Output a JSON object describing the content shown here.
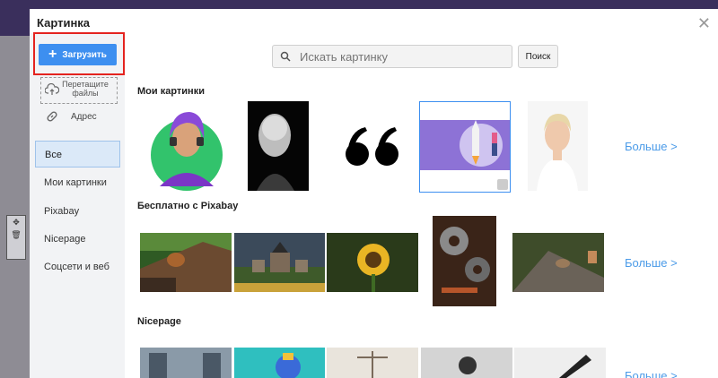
{
  "dialog": {
    "title": "Картинка"
  },
  "sidebar": {
    "upload_label": "Загрузить",
    "drop_label": "Перетащите файлы",
    "address_label": "Адрес",
    "items": [
      {
        "label": "Все"
      },
      {
        "label": "Мои картинки"
      },
      {
        "label": "Pixabay"
      },
      {
        "label": "Nicepage"
      },
      {
        "label": "Соцсети и веб"
      }
    ]
  },
  "search": {
    "placeholder": "Искать картинку",
    "button_label": "Поиск"
  },
  "sections": {
    "my_images": {
      "title": "Мои картинки",
      "more": "Больше >"
    },
    "pixabay": {
      "title": "Бесплатно с Pixabay",
      "more": "Больше >"
    },
    "nicepage": {
      "title": "Nicepage",
      "more": "Больше >"
    }
  },
  "colors": {
    "accent": "#3d8ff0",
    "highlight": "#e4231f",
    "link": "#4b9be8"
  }
}
